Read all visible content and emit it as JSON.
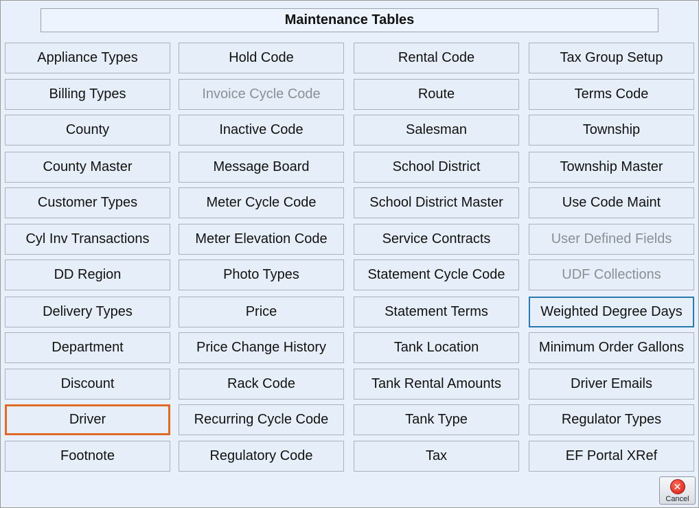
{
  "header": {
    "title": "Maintenance Tables"
  },
  "columns": [
    [
      "Appliance Types",
      "Billing Types",
      "County",
      "County Master",
      "Customer Types",
      "Cyl Inv Transactions",
      "DD Region",
      "Delivery Types",
      "Department",
      "Discount",
      "Driver",
      "Footnote"
    ],
    [
      "Hold Code",
      "Invoice Cycle Code",
      "Inactive Code",
      "Message Board",
      "Meter Cycle Code",
      "Meter Elevation Code",
      "Photo Types",
      "Price",
      "Price Change History",
      "Rack Code",
      "Recurring Cycle Code",
      "Regulatory Code"
    ],
    [
      "Rental Code",
      "Route",
      "Salesman",
      "School District",
      "School District Master",
      "Service Contracts",
      "Statement Cycle Code",
      "Statement Terms",
      "Tank Location",
      "Tank Rental Amounts",
      "Tank Type",
      "Tax"
    ],
    [
      "Tax Group Setup",
      "Terms Code",
      "Township",
      "Township Master",
      "Use Code Maint",
      "User Defined Fields",
      "UDF Collections",
      "Weighted Degree Days",
      "Minimum Order Gallons",
      "Driver Emails",
      "Regulator Types",
      "EF Portal XRef"
    ]
  ],
  "disabled": [
    "Invoice Cycle Code",
    "User Defined Fields",
    "UDF Collections"
  ],
  "focused": "Weighted Degree Days",
  "selected": "Driver",
  "footer": {
    "cancel_label": "Cancel",
    "cancel_icon": "cancel-icon"
  },
  "colors": {
    "background": "#e8f0fb",
    "selected_border": "#e06a24",
    "focus_border": "#2a78b0",
    "disabled_text": "#8a8f95"
  }
}
